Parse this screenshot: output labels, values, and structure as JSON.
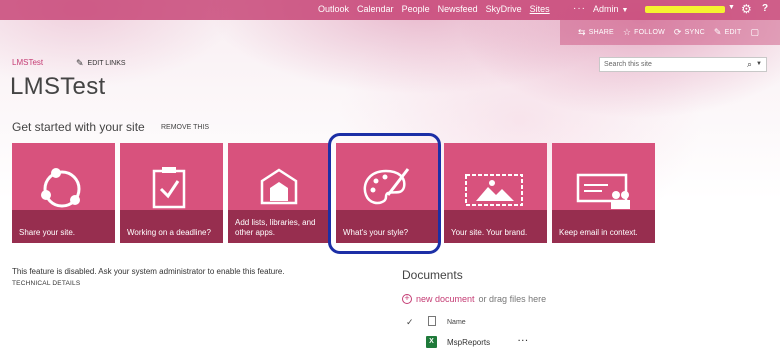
{
  "suite_bar": {
    "links": [
      "Outlook",
      "Calendar",
      "People",
      "Newsfeed",
      "SkyDrive",
      "Sites"
    ],
    "active_link": "Sites",
    "more": "···",
    "admin_label": "Admin"
  },
  "actions": {
    "share": "SHARE",
    "follow": "FOLLOW",
    "sync": "SYNC",
    "edit": "EDIT"
  },
  "breadcrumb": "LMSTest",
  "edit_links": "EDIT LINKS",
  "site_title": "LMSTest",
  "search": {
    "placeholder": "Search this site"
  },
  "get_started": {
    "heading": "Get started with your site",
    "remove": "REMOVE THIS",
    "tiles": [
      {
        "label": "Share your site.",
        "icon": "share-icon"
      },
      {
        "label": "Working on a deadline?",
        "icon": "clipboard-check-icon"
      },
      {
        "label": "Add lists, libraries, and other apps.",
        "icon": "apps-house-icon"
      },
      {
        "label": "What's your style?",
        "icon": "palette-icon"
      },
      {
        "label": "Your site. Your brand.",
        "icon": "image-frame-icon"
      },
      {
        "label": "Keep email in context.",
        "icon": "email-people-icon"
      }
    ]
  },
  "feature_message": "This feature is disabled. Ask your system administrator to enable this feature.",
  "technical_details": "TECHNICAL DETAILS",
  "documents": {
    "title": "Documents",
    "new_document": "new document",
    "drag_text": " or drag files here",
    "column_name": "Name",
    "files": [
      {
        "name": "MspReports",
        "type": "xlsx"
      }
    ]
  },
  "colors": {
    "accent": "#c53c74",
    "tile": "#d8527d",
    "tile_label_bg": "#701834",
    "highlight_ring": "#1c2fa6"
  }
}
